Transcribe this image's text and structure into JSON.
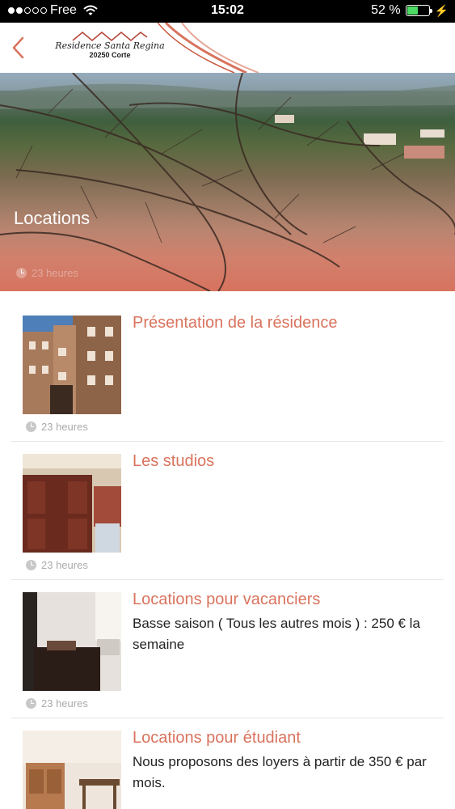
{
  "status_bar": {
    "carrier": "Free",
    "time": "15:02",
    "battery_text": "52 %",
    "battery_level": 0.52
  },
  "nav": {
    "logo_name": "Residence Santa Regina",
    "logo_zip": "20250 Corte"
  },
  "hero": {
    "title": "Locations",
    "time_ago": "23 heures"
  },
  "items": [
    {
      "title": "Présentation de la résidence",
      "excerpt": "",
      "time_ago": "23 heures",
      "thumb_icon": "building-photo"
    },
    {
      "title": "Les studios",
      "excerpt": "",
      "time_ago": "23 heures",
      "thumb_icon": "door-photo"
    },
    {
      "title": "Locations pour vacanciers",
      "excerpt": "Basse saison ( Tous les autres mois ) : 250 € la semaine",
      "time_ago": "23 heures",
      "thumb_icon": "bedroom-photo"
    },
    {
      "title": "Locations pour étudiant",
      "excerpt": "Nous proposons des loyers à partir de 350 € par mois.",
      "time_ago": "",
      "thumb_icon": "kitchen-photo"
    }
  ],
  "colors": {
    "accent": "#d9735d",
    "status_bar_bg": "#000000",
    "battery_green": "#4cd964"
  }
}
